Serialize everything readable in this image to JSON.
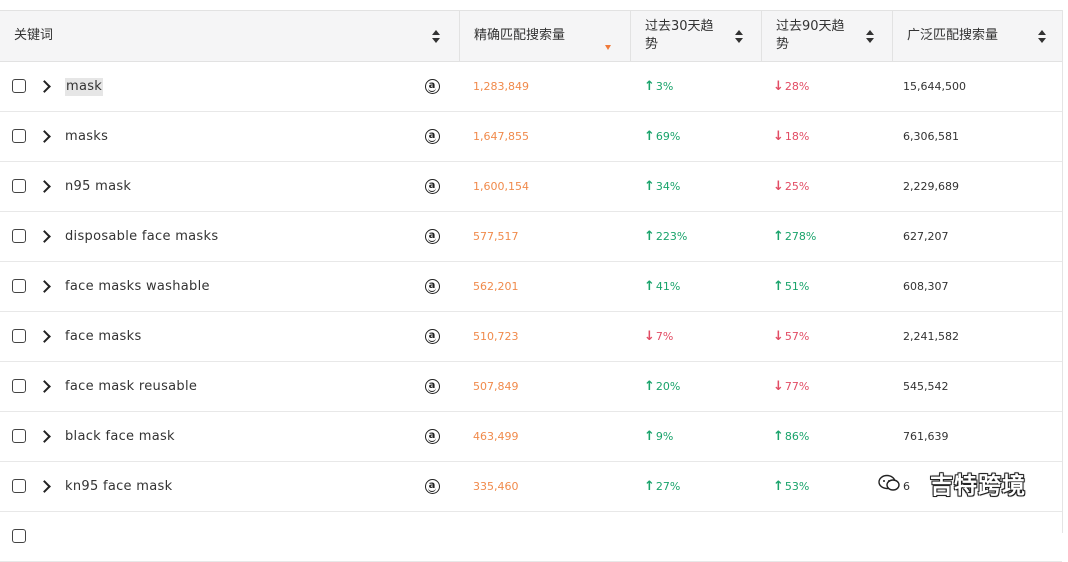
{
  "headers": {
    "keyword": "关键词",
    "exact": "精确匹配搜索量",
    "trend30": "过去30天趋势",
    "trend90": "过去90天趋势",
    "broad": "广泛匹配搜索量"
  },
  "rows": [
    {
      "keyword": "mask",
      "exact": "1,283,849",
      "t30": "3%",
      "t30_dir": "up",
      "t90": "28%",
      "t90_dir": "down",
      "broad": "15,644,500"
    },
    {
      "keyword": "masks",
      "exact": "1,647,855",
      "t30": "69%",
      "t30_dir": "up",
      "t90": "18%",
      "t90_dir": "down",
      "broad": "6,306,581"
    },
    {
      "keyword": "n95 mask",
      "exact": "1,600,154",
      "t30": "34%",
      "t30_dir": "up",
      "t90": "25%",
      "t90_dir": "down",
      "broad": "2,229,689"
    },
    {
      "keyword": "disposable face masks",
      "exact": "577,517",
      "t30": "223%",
      "t30_dir": "up",
      "t90": "278%",
      "t90_dir": "up",
      "broad": "627,207"
    },
    {
      "keyword": "face masks washable",
      "exact": "562,201",
      "t30": "41%",
      "t30_dir": "up",
      "t90": "51%",
      "t90_dir": "up",
      "broad": "608,307"
    },
    {
      "keyword": "face masks",
      "exact": "510,723",
      "t30": "7%",
      "t30_dir": "down",
      "t90": "57%",
      "t90_dir": "down",
      "broad": "2,241,582"
    },
    {
      "keyword": "face mask reusable",
      "exact": "507,849",
      "t30": "20%",
      "t30_dir": "up",
      "t90": "77%",
      "t90_dir": "down",
      "broad": "545,542"
    },
    {
      "keyword": "black face mask",
      "exact": "463,499",
      "t30": "9%",
      "t30_dir": "up",
      "t90": "86%",
      "t90_dir": "up",
      "broad": "761,639"
    },
    {
      "keyword": "kn95 face mask",
      "exact": "335,460",
      "t30": "27%",
      "t30_dir": "up",
      "t90": "53%",
      "t90_dir": "up",
      "broad": "6"
    }
  ],
  "colors": {
    "exact": "#f08a4b",
    "up": "#19a36b",
    "down": "#e24c64",
    "active_sort": "#f07a3a"
  },
  "icons": {
    "row_marketplace": "amazon-icon",
    "trend_up": "arrow-up-icon",
    "trend_down": "arrow-down-icon"
  },
  "watermark": {
    "text": "吉特跨境"
  }
}
